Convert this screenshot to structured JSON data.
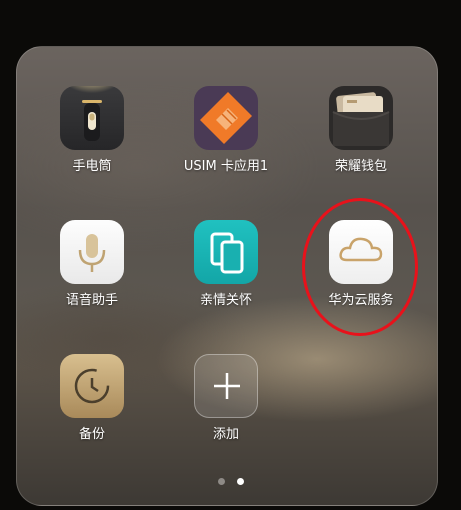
{
  "colors": {
    "annotation": "#e8121b",
    "dot_active": "#ffffff",
    "dot_inactive": "#8e8a86",
    "label": "#ffffff",
    "care_teal": "#1bb6b6",
    "cloud_gold": "#c9a36a",
    "backup_gold": "#c4a671",
    "usim_orange": "#f07a28"
  },
  "folder": {
    "apps": [
      {
        "label": "手电筒",
        "icon": "flashlight-icon"
      },
      {
        "label": "USIM 卡应用1",
        "icon": "sim-card-icon"
      },
      {
        "label": "荣耀钱包",
        "icon": "wallet-icon"
      },
      {
        "label": "语音助手",
        "icon": "microphone-icon"
      },
      {
        "label": "亲情关怀",
        "icon": "family-care-icon"
      },
      {
        "label": "华为云服务",
        "icon": "cloud-icon"
      },
      {
        "label": "备份",
        "icon": "backup-icon"
      },
      {
        "label": "添加",
        "icon": "plus-icon"
      }
    ],
    "pagination": {
      "pages": 2,
      "current": 2
    }
  }
}
